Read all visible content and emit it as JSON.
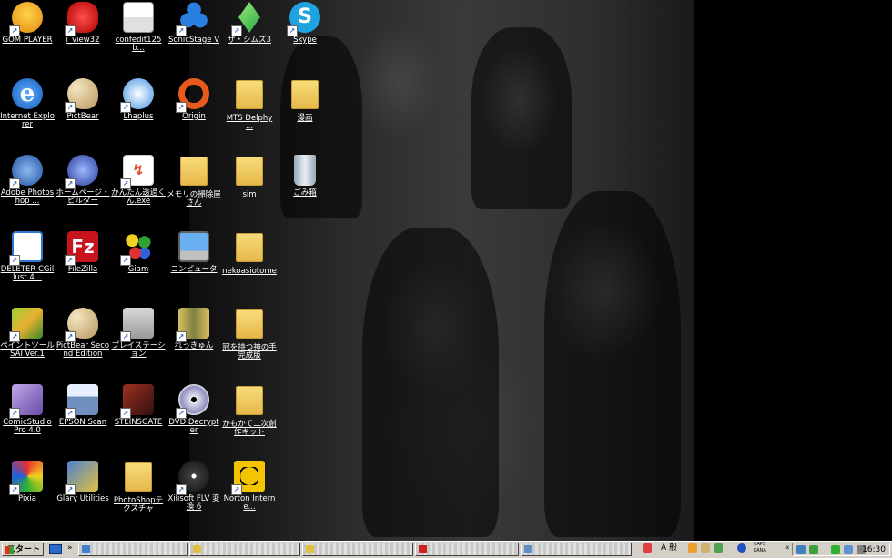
{
  "desktop": {
    "icons": [
      {
        "label": "GOM PLAYER"
      },
      {
        "label": "i_view32"
      },
      {
        "label": "confedit125b..."
      },
      {
        "label": "SonicStage V"
      },
      {
        "label": "ザ・シムズ3"
      },
      {
        "label": "Skype"
      },
      {
        "label": "Internet Explorer"
      },
      {
        "label": "PictBear"
      },
      {
        "label": "Lhaplus"
      },
      {
        "label": "Origin"
      },
      {
        "label": "MTS Delphy ..."
      },
      {
        "label": "漫画"
      },
      {
        "label": "Adobe Photoshop ..."
      },
      {
        "label": "ホームページ・ビルダー"
      },
      {
        "label": "かんたん透過くん.exe"
      },
      {
        "label": "メモリの掃除屋さん"
      },
      {
        "label": "sim"
      },
      {
        "label": "ごみ箱"
      },
      {
        "label": "DELETER CGillust 4..."
      },
      {
        "label": "FileZilla"
      },
      {
        "label": "Giam"
      },
      {
        "label": "コンピュータ"
      },
      {
        "label": "nekoasiotome"
      },
      {
        "label": "ペイントツールSAI Ver.1"
      },
      {
        "label": "PictBear Second Edition"
      },
      {
        "label": "プレイステーション"
      },
      {
        "label": "れっきゅん"
      },
      {
        "label": "冠を持つ神の手 完成版"
      },
      {
        "label": "ComicStudio Pro 4.0"
      },
      {
        "label": "EPSON Scan"
      },
      {
        "label": "STEINSGATE"
      },
      {
        "label": "DVD Decrypter"
      },
      {
        "label": "かもかて二次創作キット"
      },
      {
        "label": "Pixia"
      },
      {
        "label": "Glary Utilities"
      },
      {
        "label": "PhotoShopテクスチャ"
      },
      {
        "label": "Xilisoft FLV 変換 6"
      },
      {
        "label": "Norton Interne..."
      }
    ]
  },
  "taskbar": {
    "start_label": "スタート",
    "quicklaunch_chevron": "»",
    "ime_mode": "A 般",
    "caps": "CAPS",
    "kana": "KANA",
    "tray_chevron": "«",
    "clock": "16:30"
  },
  "colors": {
    "desktop_bg": "#000000",
    "taskbar_bg": "#d4d0c8",
    "folder": "#e6b84a",
    "skype": "#1fa3e0",
    "ie": "#2a78d0",
    "origin": "#e85a1c",
    "norton": "#f5c400",
    "filezilla": "#c8121c"
  }
}
